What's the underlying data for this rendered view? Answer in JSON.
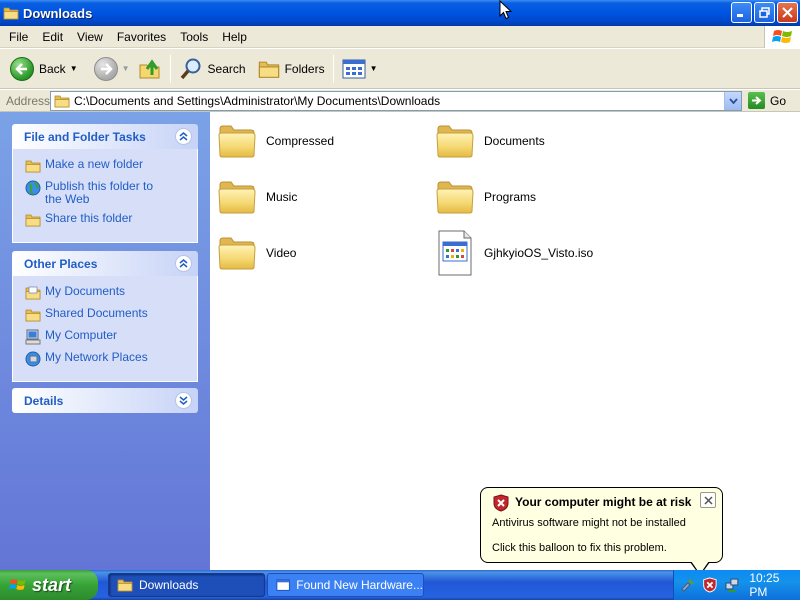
{
  "window": {
    "title": "Downloads"
  },
  "menu": [
    "File",
    "Edit",
    "View",
    "Favorites",
    "Tools",
    "Help"
  ],
  "toolbar": {
    "back_label": "Back",
    "search_label": "Search",
    "folders_label": "Folders"
  },
  "address": {
    "label": "Address",
    "value": "C:\\Documents and Settings\\Administrator\\My Documents\\Downloads",
    "go_label": "Go"
  },
  "taskpane": {
    "file_tasks": {
      "title": "File and Folder Tasks",
      "items": [
        {
          "label": "Make a new folder",
          "icon": "new-folder-icon"
        },
        {
          "label": "Publish this folder to the Web",
          "icon": "globe-icon"
        },
        {
          "label": "Share this folder",
          "icon": "share-folder-icon"
        }
      ]
    },
    "other_places": {
      "title": "Other Places",
      "items": [
        {
          "label": "My Documents",
          "icon": "my-documents-icon"
        },
        {
          "label": "Shared Documents",
          "icon": "folder-icon"
        },
        {
          "label": "My Computer",
          "icon": "computer-icon"
        },
        {
          "label": "My Network Places",
          "icon": "network-icon"
        }
      ]
    },
    "details": {
      "title": "Details"
    }
  },
  "files": [
    {
      "name": "Compressed",
      "type": "folder"
    },
    {
      "name": "Documents",
      "type": "folder"
    },
    {
      "name": "Music",
      "type": "folder"
    },
    {
      "name": "Programs",
      "type": "folder"
    },
    {
      "name": "Video",
      "type": "folder"
    },
    {
      "name": "GjhkyioOS_Visto.iso",
      "type": "file"
    }
  ],
  "balloon": {
    "title": "Your computer might be at risk",
    "line1": "Antivirus software might not be installed",
    "line2": "Click this balloon to fix this problem."
  },
  "taskbar": {
    "start_label": "start",
    "tasks": [
      {
        "label": "Downloads",
        "active": true
      },
      {
        "label": "Found New Hardware...",
        "active": false
      }
    ],
    "clock": "10:25 PM"
  },
  "colors": {
    "title_bar": "#0054e3",
    "task_link": "#215dc6",
    "pane_bg": "#6f8fe0",
    "balloon_bg": "#ffffe1",
    "start_green": "#37a337"
  }
}
